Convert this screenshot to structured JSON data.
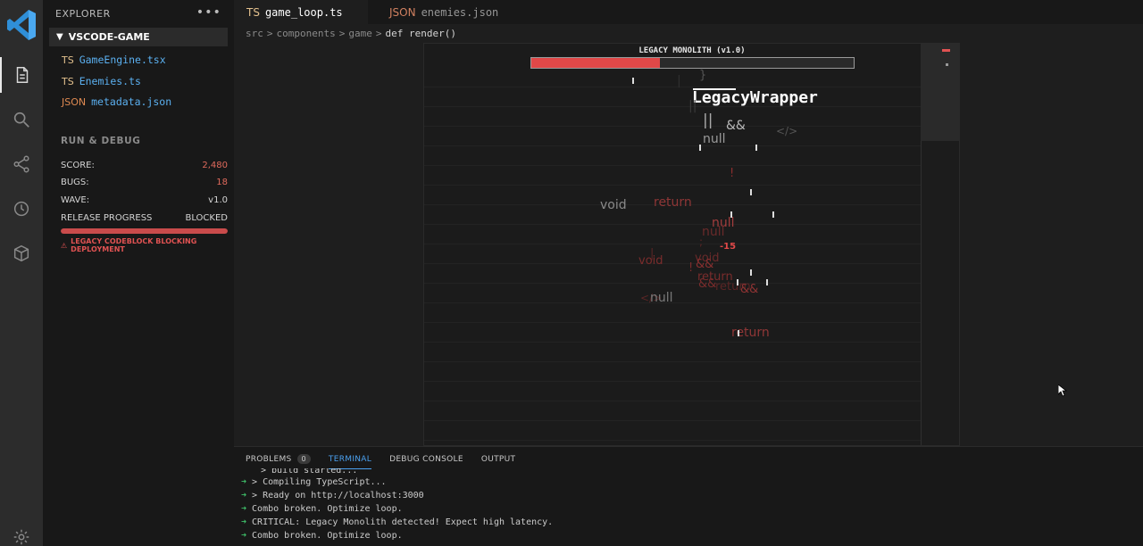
{
  "activity_bar": {
    "icons": [
      "vscode-logo",
      "files-icon",
      "search-icon",
      "source-control-icon",
      "timeline-icon",
      "extensions-icon",
      "gear-icon"
    ]
  },
  "sidebar": {
    "title": "EXPLORER",
    "more": "•••",
    "project": "VSCODE-GAME",
    "files": [
      {
        "ext": "TS",
        "name": "GameEngine.tsx"
      },
      {
        "ext": "TS",
        "name": "Enemies.ts"
      },
      {
        "ext": "JSON",
        "name": "metadata.json"
      }
    ],
    "run_debug": {
      "title": "RUN & DEBUG",
      "stats": [
        {
          "label": "SCORE:",
          "value": "2,480"
        },
        {
          "label": "BUGS:",
          "value": "18"
        },
        {
          "label": "WAVE:",
          "value": "v1.0"
        },
        {
          "label": "RELEASE PROGRESS",
          "value": "BLOCKED"
        }
      ],
      "progress_fraction": 1.0,
      "warning": "LEGACY CODEBLOCK BLOCKING DEPLOYMENT"
    }
  },
  "tabs": [
    {
      "ext": "TS",
      "name": "game_loop.ts",
      "active": true
    },
    {
      "ext": "JSON",
      "name": "enemies.json",
      "active": false
    }
  ],
  "breadcrumb": [
    "src",
    "components",
    "game",
    "def render()"
  ],
  "game": {
    "boss_name": "LEGACY MONOLITH (v1.0)",
    "boss_health_fraction": 0.4,
    "boss_title": "LegacyWrapper",
    "damage_text": "-15",
    "tokens": [
      "}",
      "||",
      "&&",
      "null",
      "</>",
      "!",
      "void",
      "return",
      "null",
      "null",
      ";",
      "void",
      "void",
      "!",
      "&&",
      "return",
      "&&",
      "return",
      "&&",
      "</>",
      "null",
      "return",
      "|",
      "|",
      "||"
    ]
  },
  "panel": {
    "tabs": [
      {
        "label": "PROBLEMS",
        "badge": "0"
      },
      {
        "label": "TERMINAL",
        "badge": ""
      },
      {
        "label": "DEBUG CONSOLE",
        "badge": ""
      },
      {
        "label": "OUTPUT",
        "badge": ""
      }
    ],
    "terminal": [
      {
        "arrow": "",
        "text": "> build started..."
      },
      {
        "arrow": "➜",
        "text": "> Compiling TypeScript..."
      },
      {
        "arrow": "➜",
        "text": "> Ready on http://localhost:3000"
      },
      {
        "arrow": "➜",
        "text": "Combo broken. Optimize loop."
      },
      {
        "arrow": "➜",
        "text": "CRITICAL: Legacy Monolith detected! Expect high latency."
      },
      {
        "arrow": "➜",
        "text": "Combo broken. Optimize loop."
      }
    ]
  }
}
